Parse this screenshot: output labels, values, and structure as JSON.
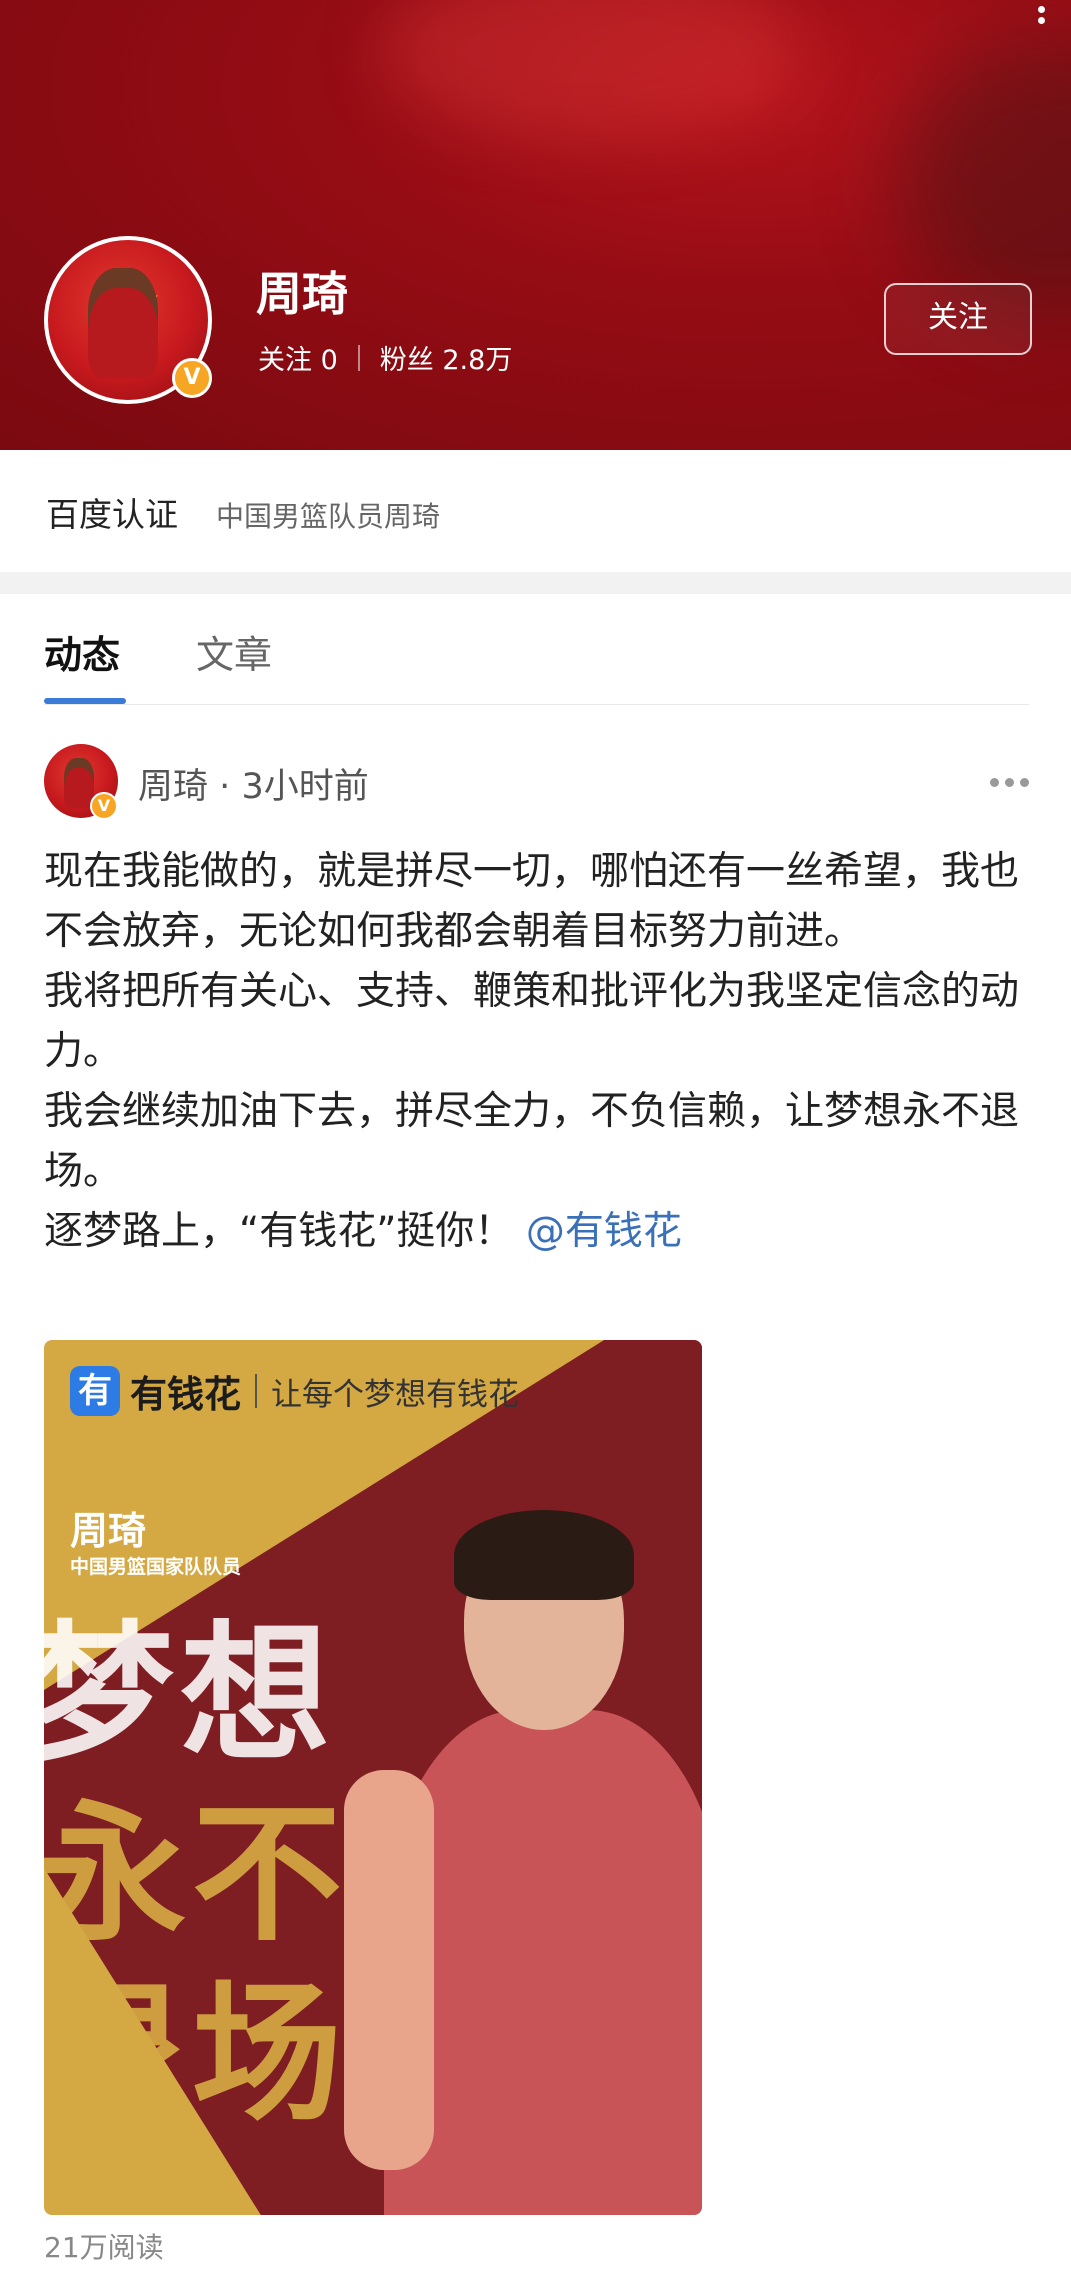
{
  "header": {
    "name": "周琦",
    "following_label": "关注",
    "following_count": "0",
    "fans_label": "粉丝",
    "fans_count": "2.8万",
    "follow_button": "关注",
    "verified_badge": "V"
  },
  "verification": {
    "label": "百度认证",
    "value": "中国男篮队员周琦"
  },
  "tabs": [
    {
      "label": "动态",
      "active": true
    },
    {
      "label": "文章",
      "active": false
    }
  ],
  "post": {
    "author": "周琦",
    "separator": "·",
    "time": "3小时前",
    "paragraphs": [
      "现在我能做的，就是拼尽一切，哪怕还有一丝希望，我也不会放弃，无论如何我都会朝着目标努力前进。",
      "我将把所有关心、支持、鞭策和批评化为我坚定信念的动力。",
      "我会继续加油下去，拼尽全力，不负信赖，让梦想永不退场。"
    ],
    "last_line": "逐梦路上，“有钱花”挺你！",
    "mention": "@有钱花",
    "image": {
      "logo_char": "有",
      "brand": "有钱花",
      "slogan": "让每个梦想有钱花",
      "person_name": "周琦",
      "person_title": "中国男篮国家队队员",
      "big_line1": "梦想",
      "big_line2": "永不",
      "big_line3": "退场"
    },
    "reads": "21万阅读"
  },
  "colors": {
    "header_red": "#950c14",
    "tab_underline": "#3a7bd5",
    "mention": "#3a70b8",
    "poster_gold": "#d4a843",
    "poster_burgundy": "#7e1d22",
    "verified": "#f6a623"
  }
}
